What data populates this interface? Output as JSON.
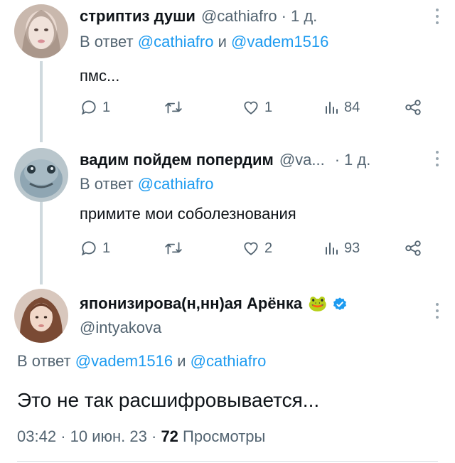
{
  "tweets": [
    {
      "name": "стриптиз души",
      "handle": "@cathiafro",
      "separator": "·",
      "time": "1 д.",
      "reply_prefix": "В ответ",
      "reply_mention_1": "@cathiafro",
      "reply_and": "и",
      "reply_mention_2": "@vadem1516",
      "text": "пмс...",
      "stats": {
        "replies": "1",
        "retweets": "",
        "likes": "1",
        "views": "84"
      }
    },
    {
      "name": "вадим пойдем попердим",
      "handle": "@va...",
      "separator": "·",
      "time": "1 д.",
      "reply_prefix": "В ответ",
      "reply_mention_1": "@cathiafro",
      "text": "примите мои соболезнования",
      "stats": {
        "replies": "1",
        "retweets": "",
        "likes": "2",
        "views": "93"
      }
    }
  ],
  "main_tweet": {
    "name": "японизирова(н,нн)ая Арёнка",
    "emoji": "🐸",
    "handle": "@intyakova",
    "reply_prefix": "В ответ",
    "reply_mention_1": "@vadem1516",
    "reply_and": "и",
    "reply_mention_2": "@cathiafro",
    "text": "Это не так расшифровывается...",
    "time": "03:42",
    "separator": "·",
    "date": "10 июн. 23",
    "views_count": "72",
    "views_label": "Просмотры"
  },
  "icons": {
    "reply": "reply-bubble-icon",
    "retweet": "retweet-icon",
    "like": "heart-icon",
    "views": "views-bar-chart-icon",
    "share": "share-icon",
    "more": "more-vertical-icon",
    "verified": "verified-badge-icon"
  },
  "colors": {
    "link": "#1d9bf0",
    "secondary": "#536471",
    "primary_text": "#0f1419",
    "thread_line": "#cfd9de",
    "verified": "#1d9bf0"
  }
}
